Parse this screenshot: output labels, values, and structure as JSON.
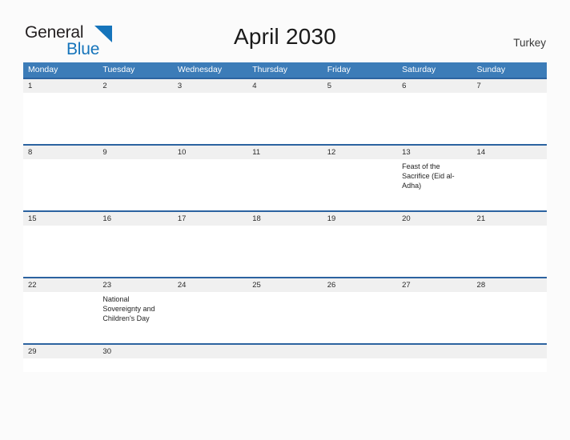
{
  "brand": {
    "name_part1": "General",
    "name_part2": "Blue",
    "triangle_icon": "triangle-icon",
    "color_dark": "#231f20",
    "color_blue": "#1574bb"
  },
  "header": {
    "title": "April 2030",
    "region": "Turkey"
  },
  "colors": {
    "weekday_header_bg": "#3c7cb8",
    "week_separator": "#2c63a0",
    "daynum_strip_bg": "#f0f0f0",
    "page_bg": "#fbfbfb"
  },
  "calendar": {
    "weekdays": [
      "Monday",
      "Tuesday",
      "Wednesday",
      "Thursday",
      "Friday",
      "Saturday",
      "Sunday"
    ],
    "weeks": [
      {
        "days": [
          {
            "num": "1",
            "event": ""
          },
          {
            "num": "2",
            "event": ""
          },
          {
            "num": "3",
            "event": ""
          },
          {
            "num": "4",
            "event": ""
          },
          {
            "num": "5",
            "event": ""
          },
          {
            "num": "6",
            "event": ""
          },
          {
            "num": "7",
            "event": ""
          }
        ]
      },
      {
        "days": [
          {
            "num": "8",
            "event": ""
          },
          {
            "num": "9",
            "event": ""
          },
          {
            "num": "10",
            "event": ""
          },
          {
            "num": "11",
            "event": ""
          },
          {
            "num": "12",
            "event": ""
          },
          {
            "num": "13",
            "event": "Feast of the Sacrifice (Eid al-Adha)"
          },
          {
            "num": "14",
            "event": ""
          }
        ]
      },
      {
        "days": [
          {
            "num": "15",
            "event": ""
          },
          {
            "num": "16",
            "event": ""
          },
          {
            "num": "17",
            "event": ""
          },
          {
            "num": "18",
            "event": ""
          },
          {
            "num": "19",
            "event": ""
          },
          {
            "num": "20",
            "event": ""
          },
          {
            "num": "21",
            "event": ""
          }
        ]
      },
      {
        "days": [
          {
            "num": "22",
            "event": ""
          },
          {
            "num": "23",
            "event": "National Sovereignty and Children's Day"
          },
          {
            "num": "24",
            "event": ""
          },
          {
            "num": "25",
            "event": ""
          },
          {
            "num": "26",
            "event": ""
          },
          {
            "num": "27",
            "event": ""
          },
          {
            "num": "28",
            "event": ""
          }
        ]
      },
      {
        "days": [
          {
            "num": "29",
            "event": ""
          },
          {
            "num": "30",
            "event": ""
          },
          {
            "num": "",
            "event": ""
          },
          {
            "num": "",
            "event": ""
          },
          {
            "num": "",
            "event": ""
          },
          {
            "num": "",
            "event": ""
          },
          {
            "num": "",
            "event": ""
          }
        ]
      }
    ]
  }
}
